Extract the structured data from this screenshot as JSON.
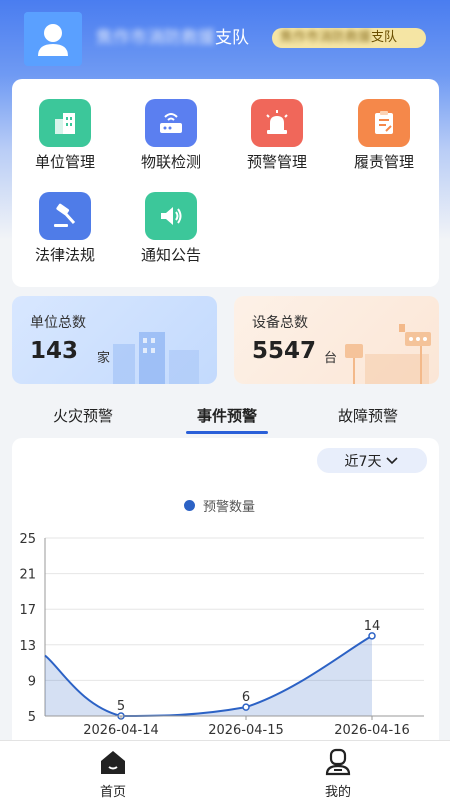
{
  "header": {
    "team_name_blurred": "焦作市消防救援",
    "team_name_suffix": "支队",
    "badge_blurred": "焦作市消防救援",
    "badge_suffix": "支队"
  },
  "menu": [
    {
      "label": "单位管理",
      "icon": "building-icon",
      "color": "#3cc79a"
    },
    {
      "label": "物联检测",
      "icon": "iot-router-icon",
      "color": "#5b7ff0"
    },
    {
      "label": "预警管理",
      "icon": "alarm-light-icon",
      "color": "#f0675a"
    },
    {
      "label": "履责管理",
      "icon": "clipboard-edit-icon",
      "color": "#f5884a"
    },
    {
      "label": "法律法规",
      "icon": "gavel-icon",
      "color": "#4f7ce8"
    },
    {
      "label": "通知公告",
      "icon": "speaker-icon",
      "color": "#3cc79a"
    }
  ],
  "stats": {
    "units": {
      "title": "单位总数",
      "value": "143",
      "unit": "家"
    },
    "devices": {
      "title": "设备总数",
      "value": "5547",
      "unit": "台"
    }
  },
  "tabs": [
    {
      "label": "火灾预警",
      "active": false
    },
    {
      "label": "事件预警",
      "active": true
    },
    {
      "label": "故障预警",
      "active": false
    }
  ],
  "range_select": {
    "value": "近7天"
  },
  "chart_data": {
    "type": "area",
    "legend": "预警数量",
    "x": [
      "",
      "2026-04-14",
      "2026-04-15",
      "2026-04-16"
    ],
    "tick_labels": [
      "2026-04-14",
      "2026-04-15",
      "2026-04-16"
    ],
    "series": [
      {
        "name": "预警数量",
        "values": [
          11.8,
          5,
          6,
          14
        ],
        "color": "#2c62c5"
      }
    ],
    "data_labels": [
      "",
      "5",
      "6",
      "14"
    ],
    "ylim": [
      5,
      25
    ],
    "yticks": [
      5,
      9,
      13,
      17,
      21,
      25
    ],
    "grid": true
  },
  "bottom_nav": [
    {
      "label": "首页",
      "icon": "home-icon"
    },
    {
      "label": "我的",
      "icon": "user-icon"
    }
  ]
}
